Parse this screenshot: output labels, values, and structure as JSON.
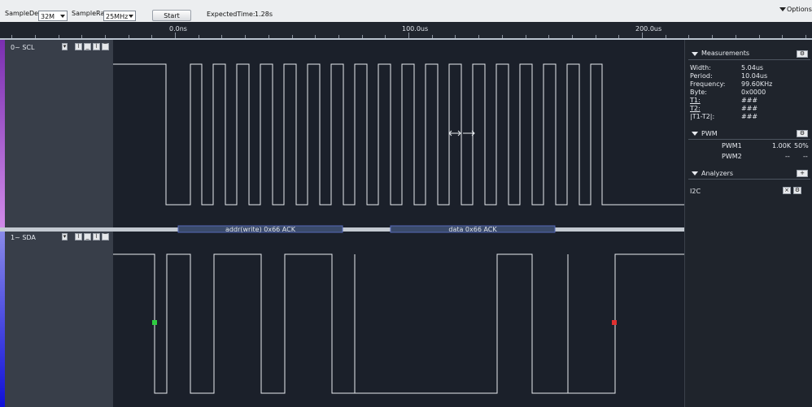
{
  "toolbar": {
    "sample_depth_label": "SampleDepth",
    "sample_depth_value": "32M",
    "sample_rate_label": "SampleRate",
    "sample_rate_value": "25MHz",
    "start_label": "Start",
    "expected_time_label": "ExpectedTime:",
    "expected_time_value": "1.28s",
    "options_label": "Options"
  },
  "ruler": {
    "labels": [
      "0.0ns",
      "100.0us",
      "200.0us"
    ]
  },
  "channels": [
    {
      "name": "0~ SCL",
      "color": "#b06ad8"
    },
    {
      "name": "1~ SDA",
      "color": "#2030e0"
    }
  ],
  "decoder": {
    "addr_label": "addr(write) 0x66 ACK",
    "data_label": "data 0x66 ACK"
  },
  "measurements": {
    "title": "Measurements",
    "rows": [
      {
        "label": "Width:",
        "value": "5.04us"
      },
      {
        "label": "Period:",
        "value": "10.04us"
      },
      {
        "label": "Frequency:",
        "value": "99.60KHz"
      },
      {
        "label": "Byte:",
        "value": "0x0000"
      },
      {
        "label": "T1:",
        "value": "###"
      },
      {
        "label": "T2:",
        "value": "###"
      },
      {
        "label": "|T1-T2|:",
        "value": "###"
      }
    ]
  },
  "pwm": {
    "title": "PWM",
    "rows": [
      {
        "name": "PWM1",
        "freq": "1.00K",
        "duty": "50%"
      },
      {
        "name": "PWM2",
        "freq": "--",
        "duty": "--"
      }
    ]
  },
  "analyzers": {
    "title": "Analyzers",
    "items": [
      "I2C"
    ]
  },
  "colors": {
    "background": "#1b202a",
    "waveform": "#e8ecf0",
    "decoder_fill": "#3a4a6a",
    "decoder_border": "#5568b8",
    "start_marker": "#2ecc40",
    "end_marker": "#e03030"
  },
  "icons": {
    "options": "triangle-down-icon",
    "gear": "gear-icon",
    "add": "plus-icon",
    "close": "close-icon"
  }
}
